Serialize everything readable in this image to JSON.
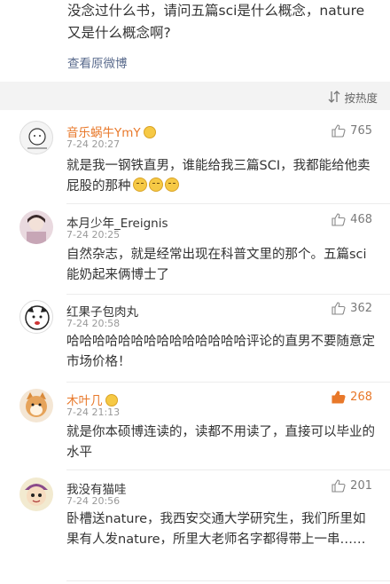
{
  "post": {
    "text": "没念过什么书，请问五篇sci是什么概念，nature又是什么概念啊?",
    "view_original": "查看原微博"
  },
  "sort": {
    "label": "按热度"
  },
  "comments": [
    {
      "user": "音乐蜗牛YmY",
      "time": "7-24 20:27",
      "likes": "765",
      "text": "就是我一钢铁直男，谁能给我三篇SCI，我都能给他卖屁股的那种"
    },
    {
      "user": "本月少年_Ereignis",
      "time": "7-24 20:25",
      "likes": "468",
      "text": "自然杂志，就是经常出现在科普文里的那个。五篇sci能奶起来俩博士了"
    },
    {
      "user": "红果子包肉丸",
      "time": "7-24 20:58",
      "likes": "362",
      "text": "哈哈哈哈哈哈哈哈哈哈哈哈哈哈评论的直男不要随意定市场价格！"
    },
    {
      "user": "木叶几",
      "time": "7-24 21:13",
      "likes": "268",
      "text": "就是你本硕博连读的，读都不用读了，直接可以毕业的水平"
    },
    {
      "user": "我没有猫哇",
      "time": "7-24 20:56",
      "likes": "201",
      "text": "卧槽送nature，我西安交通大学研究生，我们所里如果有人发nature，所里大老师名字都得带上一串……"
    }
  ],
  "colors": {
    "accent": "#e8782a",
    "link": "#5b6c8e",
    "muted": "#999999"
  }
}
